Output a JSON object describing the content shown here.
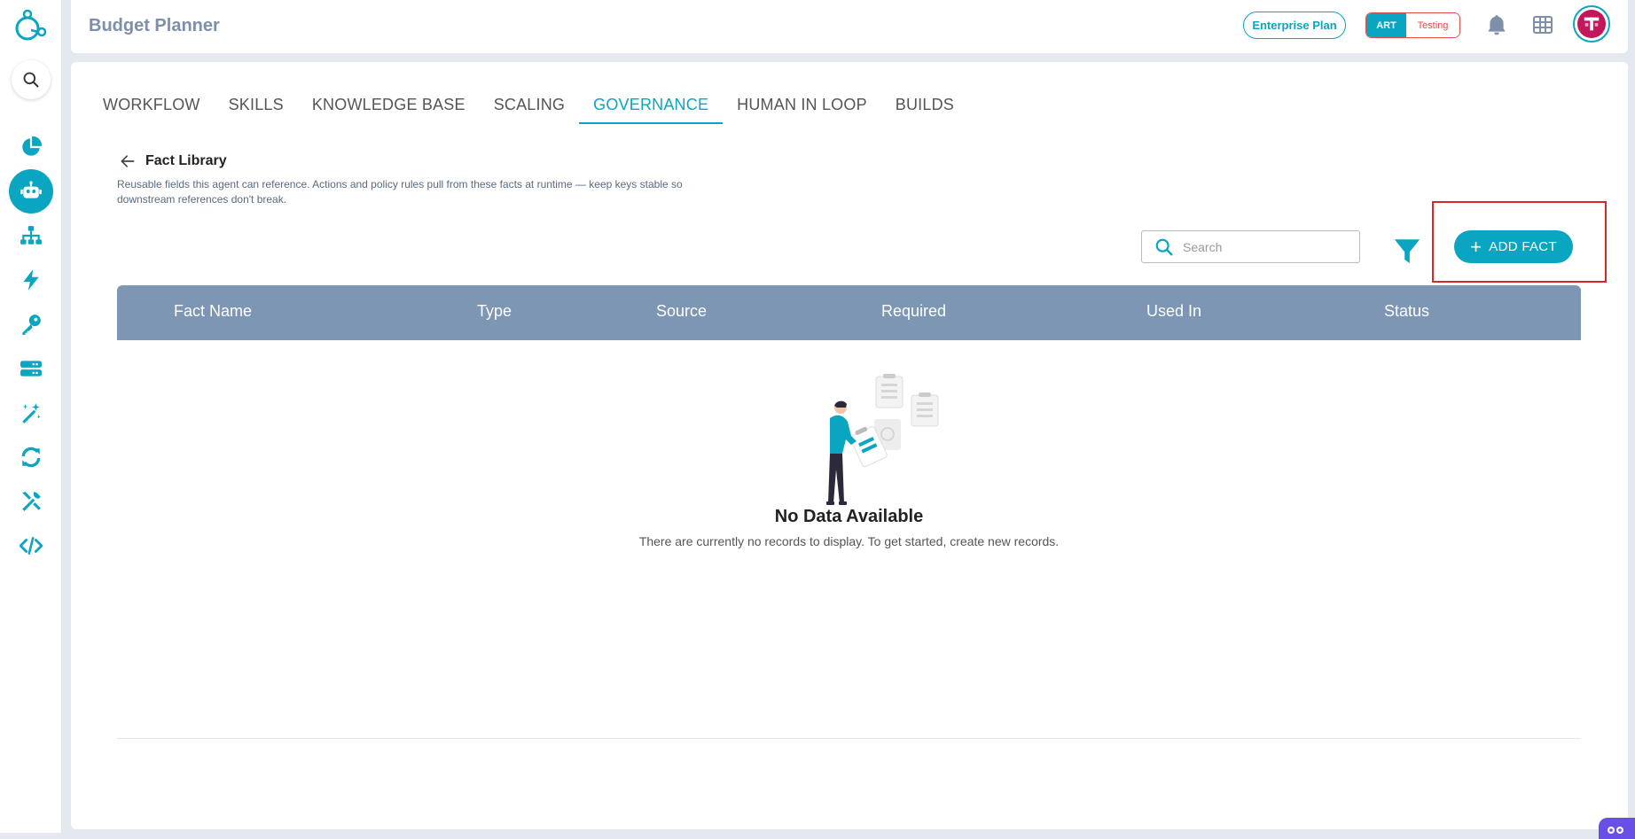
{
  "app": {
    "title": "Budget Planner"
  },
  "header": {
    "plan_label": "Enterprise Plan",
    "env_active": "ART",
    "env_inactive": "Testing"
  },
  "sidebar": {
    "items": [
      {
        "name": "analytics",
        "icon": "pie-chart-icon"
      },
      {
        "name": "agents",
        "icon": "robot-icon",
        "active": true
      },
      {
        "name": "hierarchy",
        "icon": "sitemap-icon"
      },
      {
        "name": "actions",
        "icon": "lightning-icon"
      },
      {
        "name": "keys",
        "icon": "key-icon"
      },
      {
        "name": "servers",
        "icon": "server-icon"
      },
      {
        "name": "magic",
        "icon": "magic-wand-icon"
      },
      {
        "name": "sync",
        "icon": "refresh-icon"
      },
      {
        "name": "tools",
        "icon": "tools-icon"
      },
      {
        "name": "code",
        "icon": "code-icon"
      }
    ]
  },
  "tabs": [
    {
      "label": "WORKFLOW"
    },
    {
      "label": "SKILLS"
    },
    {
      "label": "KNOWLEDGE BASE"
    },
    {
      "label": "SCALING"
    },
    {
      "label": "GOVERNANCE",
      "active": true
    },
    {
      "label": "HUMAN IN LOOP"
    },
    {
      "label": "BUILDS"
    }
  ],
  "page": {
    "title": "Fact Library",
    "description": "Reusable fields this agent can reference. Actions and policy rules pull from these facts at runtime — keep keys stable so downstream references don't break."
  },
  "toolbar": {
    "search_placeholder": "Search",
    "add_label": "ADD FACT"
  },
  "table": {
    "columns": [
      "Fact Name",
      "Type",
      "Source",
      "Required",
      "Used In",
      "Status"
    ]
  },
  "empty_state": {
    "title": "No Data Available",
    "message": "There are currently no records to display. To get started, create new records."
  },
  "colors": {
    "accent": "#0aa5c0",
    "table_header": "#7d96b4",
    "highlight": "#d9262c"
  }
}
